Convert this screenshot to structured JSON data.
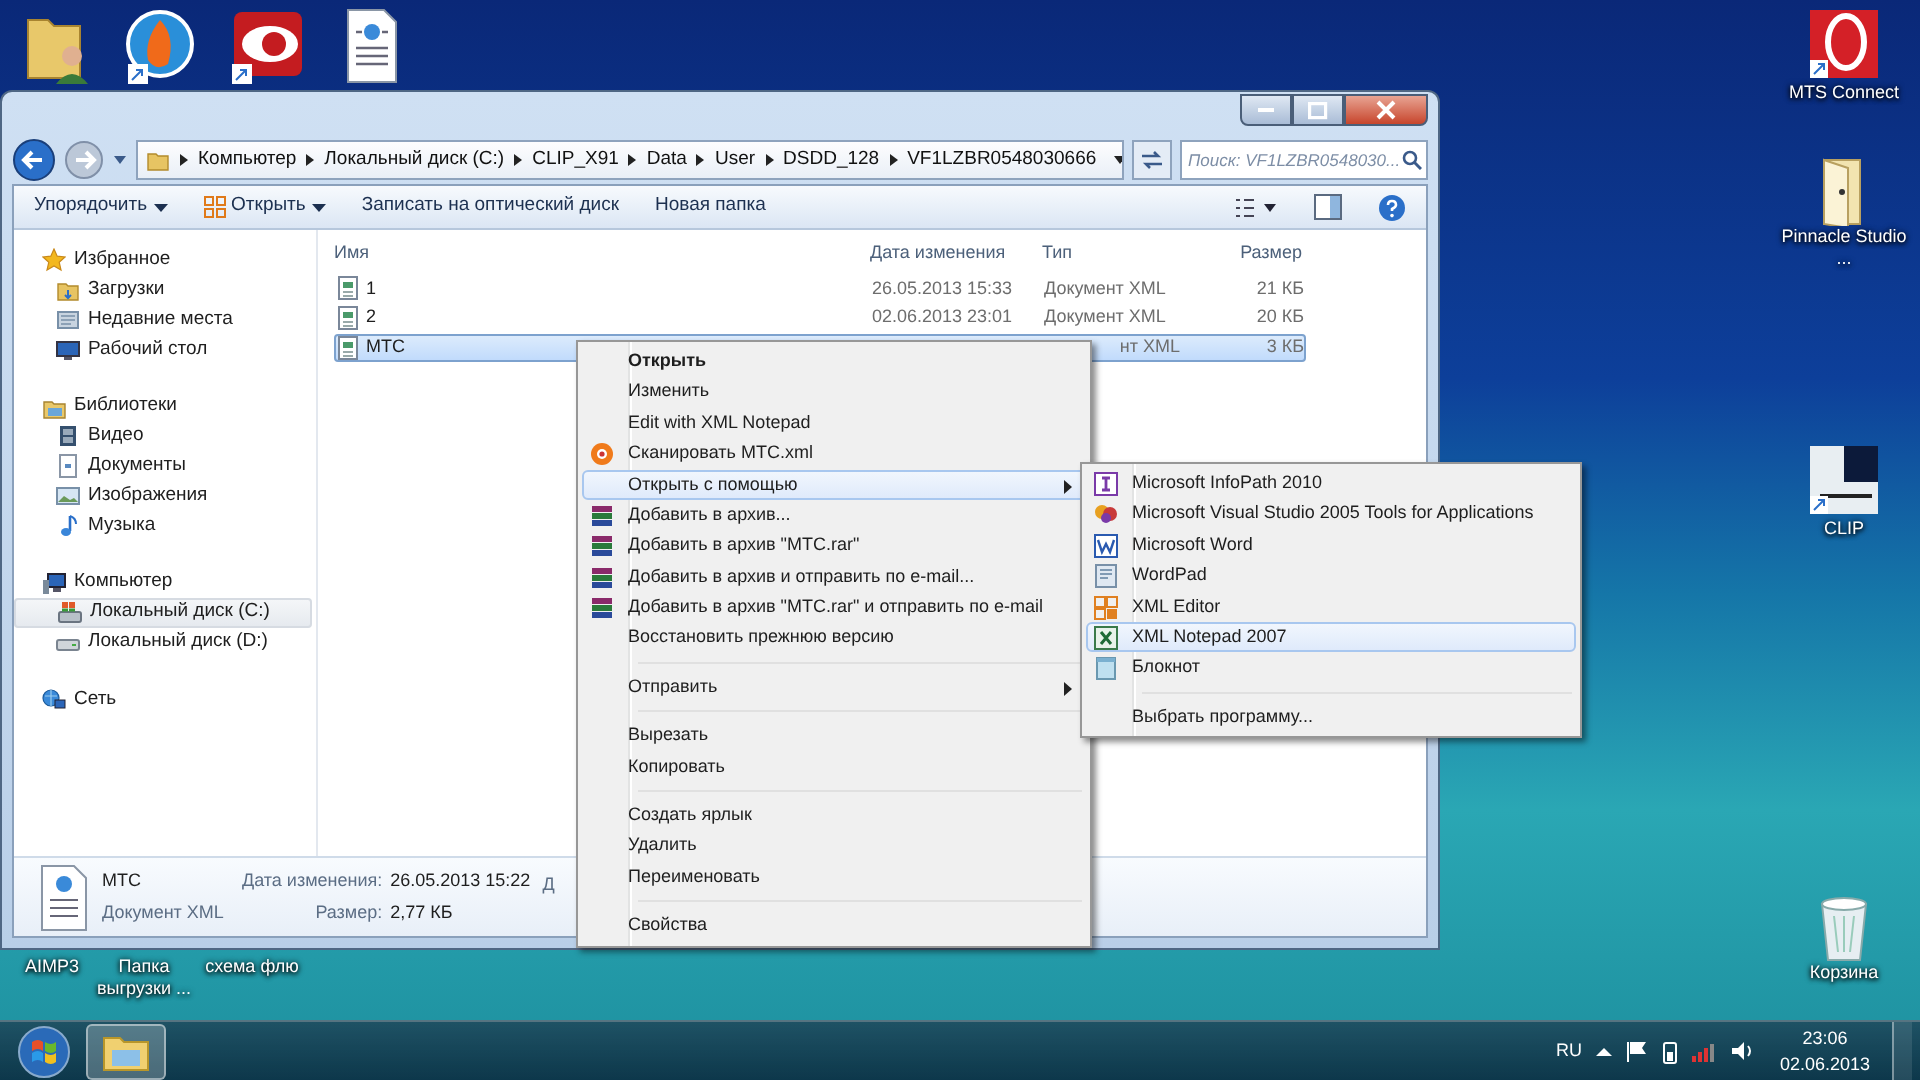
{
  "right_icons": [
    {
      "kind": "mts",
      "label": "MTS Connect"
    },
    {
      "kind": "folder",
      "label": "Pinnacle Studio ..."
    },
    {
      "kind": "clip",
      "label": "CLIP"
    },
    {
      "kind": "trash",
      "label": "Корзина"
    }
  ],
  "bottom_labels": [
    "AIMP3",
    "Папка выгрузки ...",
    "схема флю"
  ],
  "explorer": {
    "breadcrumb": [
      "Компьютер",
      "Локальный диск (C:)",
      "CLIP_X91",
      "Data",
      "User",
      "DSDD_128",
      "VF1LZBR0548030666"
    ],
    "search": {
      "placeholder": "Поиск: VF1LZBR0548030..."
    },
    "toolbar": [
      {
        "label": "Упорядочить",
        "kind": "menu"
      },
      {
        "label": "Открыть",
        "kind": "open"
      },
      {
        "label": "Записать на оптический диск",
        "kind": "plain"
      },
      {
        "label": "Новая папка",
        "kind": "plain"
      }
    ],
    "nav": [
      {
        "label": "Избранное",
        "kind": "star",
        "selected": false,
        "children": [
          {
            "label": "Загрузки",
            "kind": "folder",
            "selected": false
          },
          {
            "label": "Недавние места",
            "kind": "recent",
            "selected": false
          },
          {
            "label": "Рабочий стол",
            "kind": "desktop",
            "selected": false
          }
        ]
      },
      {
        "label": "Библиотеки",
        "kind": "library",
        "selected": false,
        "children": [
          {
            "label": "Видео",
            "kind": "video",
            "selected": false
          },
          {
            "label": "Документы",
            "kind": "doc",
            "selected": false
          },
          {
            "label": "Изображения",
            "kind": "image",
            "selected": false
          },
          {
            "label": "Музыка",
            "kind": "music",
            "selected": false
          }
        ]
      },
      {
        "label": "Компьютер",
        "kind": "computer",
        "selected": false,
        "children": [
          {
            "label": "Локальный диск (C:)",
            "kind": "sysdrive",
            "selected": true
          },
          {
            "label": "Локальный диск (D:)",
            "kind": "drive",
            "selected": false
          }
        ]
      },
      {
        "label": "Сеть",
        "kind": "network",
        "selected": false
      }
    ],
    "columns": [
      "Имя",
      "Дата изменения",
      "Тип",
      "Размер"
    ],
    "files": [
      {
        "name": "1",
        "date": "26.05.2013 15:33",
        "type": "Документ XML",
        "size": "21 КБ",
        "selected": false
      },
      {
        "name": "2",
        "date": "02.06.2013 23:01",
        "type": "Документ XML",
        "size": "20 КБ",
        "selected": false
      },
      {
        "name": "MTC",
        "type": "нт XML",
        "size": "3 КБ",
        "selected": true
      }
    ],
    "details": {
      "name": "MTC",
      "type": "Документ XML",
      "fields": [
        {
          "label": "Дата изменения:",
          "value": "26.05.2013 15:22"
        },
        {
          "label": "Размер:",
          "value": "2,77 КБ"
        }
      ],
      "cut_label": "Д"
    }
  },
  "context_menu": [
    {
      "kind": "plain",
      "label": "Открыть",
      "bold": true,
      "selected": false
    },
    {
      "kind": "plain",
      "label": "Изменить",
      "bold": false,
      "selected": false
    },
    {
      "kind": "plain",
      "label": "Edit with XML Notepad",
      "bold": false,
      "selected": false
    },
    {
      "kind": "scan",
      "label": "Сканировать MTC.xml",
      "bold": false,
      "selected": false
    },
    {
      "kind": "submenu",
      "label": "Открыть с помощью",
      "bold": false,
      "selected": true
    },
    {
      "kind": "archive",
      "label": "Добавить в архив...",
      "bold": false,
      "selected": false
    },
    {
      "kind": "archive",
      "label": "Добавить в архив \"MTC.rar\"",
      "bold": false,
      "selected": false
    },
    {
      "kind": "archive",
      "label": "Добавить в архив и отправить по e-mail...",
      "bold": false,
      "selected": false
    },
    {
      "kind": "archive",
      "label": "Добавить в архив \"MTC.rar\" и отправить по e-mail",
      "bold": false,
      "selected": false
    },
    {
      "kind": "plain",
      "label": "Восстановить прежнюю версию",
      "bold": false,
      "selected": false
    },
    {
      "kind": "separator"
    },
    {
      "kind": "submenu",
      "label": "Отправить",
      "bold": false,
      "selected": false
    },
    {
      "kind": "separator"
    },
    {
      "kind": "plain",
      "label": "Вырезать",
      "bold": false,
      "selected": false
    },
    {
      "kind": "plain",
      "label": "Копировать",
      "bold": false,
      "selected": false
    },
    {
      "kind": "separator"
    },
    {
      "kind": "plain",
      "label": "Создать ярлык",
      "bold": false,
      "selected": false
    },
    {
      "kind": "plain",
      "label": "Удалить",
      "bold": false,
      "selected": false
    },
    {
      "kind": "plain",
      "label": "Переименовать",
      "bold": false,
      "selected": false
    },
    {
      "kind": "separator"
    },
    {
      "kind": "plain",
      "label": "Свойства",
      "bold": false,
      "selected": false
    }
  ],
  "submenu": [
    {
      "kind": "infopath",
      "label": "Microsoft InfoPath 2010",
      "selected": false
    },
    {
      "kind": "vsta",
      "label": "Microsoft Visual Studio 2005 Tools for Applications",
      "selected": false
    },
    {
      "kind": "word",
      "label": "Microsoft Word",
      "selected": false
    },
    {
      "kind": "wordpad",
      "label": "WordPad",
      "selected": false
    },
    {
      "kind": "xmleditor",
      "label": "XML Editor",
      "selected": false
    },
    {
      "kind": "xmlnotepad",
      "label": "XML Notepad 2007",
      "selected": true
    },
    {
      "kind": "notepad",
      "label": "Блокнот",
      "selected": false
    },
    {
      "kind": "separator"
    },
    {
      "kind": "plain",
      "label": "Выбрать программу...",
      "selected": false
    }
  ],
  "taskbar": {
    "language": "RU",
    "time": "23:06",
    "date": "02.06.2013"
  }
}
